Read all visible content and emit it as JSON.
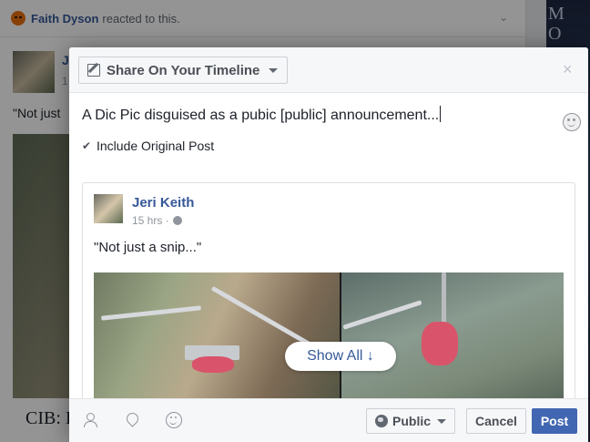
{
  "background_feed": {
    "reactor_name": "Faith Dyson",
    "reaction_text": "reacted to this.",
    "author_initial": "J",
    "time_partial": "1",
    "post_text_partial": "\"Not just",
    "caption_partial": "CIB: I",
    "side_letters": "M\nO\nG"
  },
  "dialog": {
    "share_dropdown_label": "Share On Your Timeline",
    "close_glyph": "×",
    "composer_text": "A Dic Pic disguised as a pubic [public] announcement...",
    "include_original_label": "Include Original Post",
    "include_original_checked": true,
    "original_post": {
      "author": "Jeri Keith",
      "time": "15 hrs ·",
      "text": "\"Not just a snip...\"",
      "show_all_label": "Show All ↓"
    },
    "footer": {
      "privacy_label": "Public",
      "cancel_label": "Cancel",
      "post_label": "Post"
    }
  },
  "colors": {
    "link_blue": "#365899",
    "primary_button": "#4267b2",
    "overlay": "rgba(0,0,0,0.42)"
  },
  "icons": [
    "angry-reaction-icon",
    "chevron-down-icon",
    "pencil-icon",
    "close-icon",
    "emoji-icon",
    "checkmark-icon",
    "globe-icon",
    "tag-people-icon",
    "location-pin-icon",
    "feeling-icon"
  ]
}
